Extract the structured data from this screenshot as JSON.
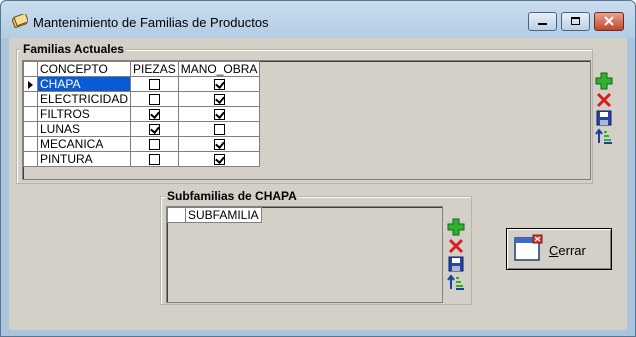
{
  "window": {
    "title": "Mantenimiento de Familias de  Productos"
  },
  "families": {
    "group_label": "Familias Actuales",
    "columns": [
      "CONCEPTO",
      "PIEZAS",
      "MANO_OBRA"
    ],
    "rows": [
      {
        "concepto": "CHAPA",
        "piezas": false,
        "mano_obra": true,
        "selected": true
      },
      {
        "concepto": "ELECTRICIDAD",
        "piezas": false,
        "mano_obra": true,
        "selected": false
      },
      {
        "concepto": "FILTROS",
        "piezas": true,
        "mano_obra": true,
        "selected": false
      },
      {
        "concepto": "LUNAS",
        "piezas": true,
        "mano_obra": false,
        "selected": false
      },
      {
        "concepto": "MECANICA",
        "piezas": false,
        "mano_obra": true,
        "selected": false
      },
      {
        "concepto": "PINTURA",
        "piezas": false,
        "mano_obra": true,
        "selected": false
      }
    ]
  },
  "subfamilies": {
    "group_label": "Subfamilias de CHAPA",
    "columns": [
      "SUBFAMILIA"
    ]
  },
  "toolbar_icons": [
    "add-icon",
    "delete-icon",
    "save-icon",
    "sort-icon"
  ],
  "close_button": {
    "label_underlined": "C",
    "label_rest": "errar"
  },
  "colors": {
    "selection": "#0a5ad6",
    "add": "#2fb12f",
    "delete": "#d62020",
    "title_bar": "#b3cde4"
  }
}
